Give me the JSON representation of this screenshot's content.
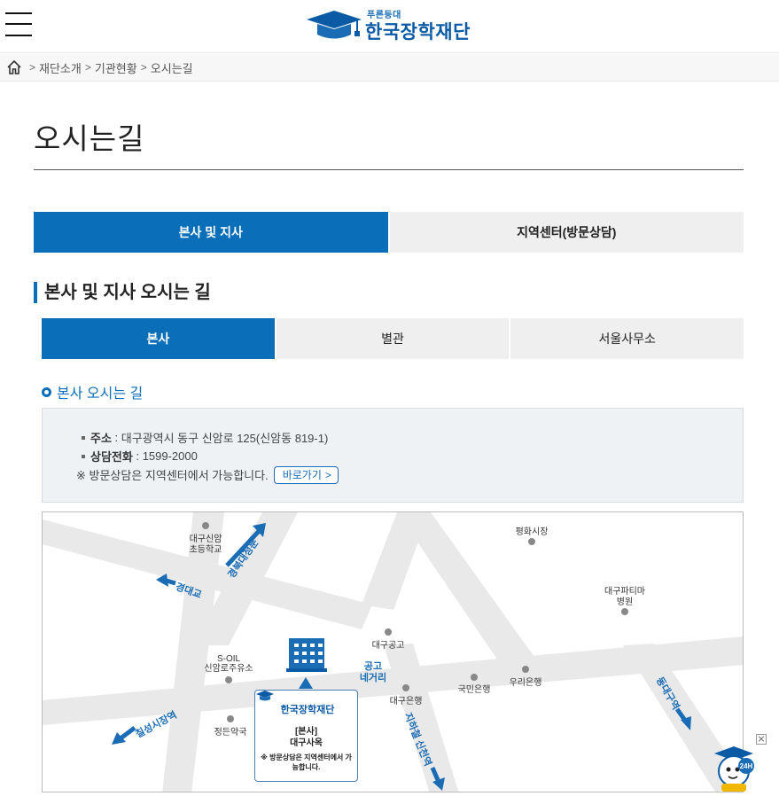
{
  "header": {
    "logo_sub": "푸른등대",
    "logo_main": "한국장학재단"
  },
  "breadcrumb": {
    "items": [
      "재단소개",
      "기관현황",
      "오시는길"
    ]
  },
  "page": {
    "title": "오시는길"
  },
  "main_tabs": [
    "본사 및 지사",
    "지역센터(방문상담)"
  ],
  "section_title": "본사 및 지사 오시는 길",
  "sub_tabs": [
    "본사",
    "별관",
    "서울사무소"
  ],
  "sub_title": "본사 오시는 길",
  "info": {
    "address_label": "주소",
    "address": "대구광역시 동구 신암로 125(신암동 819-1)",
    "phone_label": "상담전화",
    "phone": "1599-2000",
    "note": "※ 방문상담은 지역센터에서 가능합니다.",
    "go_button": "바로가기"
  },
  "map": {
    "labels": {
      "sinam_school_1": "대구신암",
      "sinam_school_2": "초등학교",
      "gyeongbuk_univ_gate": "경북대정문",
      "gyeongdae_bridge": "경대교",
      "pyeonghwa_market": "평화시장",
      "fatima_1": "대구파티마",
      "fatima_2": "병원",
      "daegu_tech_high": "대구공고",
      "soil_1": "S-OIL",
      "soil_2": "신암로주유소",
      "gonggo_1": "공고",
      "gonggo_2": "네거리",
      "kookmin_bank": "국민은행",
      "woori_bank": "우리은행",
      "daegu_bank": "대구은행",
      "dongdaegu_station": "동대구역",
      "chilseong_market": "칠성시장역",
      "jeongdeun_pharmacy": "정든약국",
      "subway_sinam": "지하철 신천역"
    },
    "card": {
      "logo": "한국장학재단",
      "title": "[본사]",
      "subtitle": "대구사옥",
      "note": "※ 방문상담은 지역센터에서 가능합니다."
    }
  },
  "colors": {
    "primary": "#0a6eb8",
    "tab_inactive": "#efefef",
    "road": "#e9e9e9",
    "arrow": "#1a6cb5"
  },
  "chatbot_badge": "24H"
}
